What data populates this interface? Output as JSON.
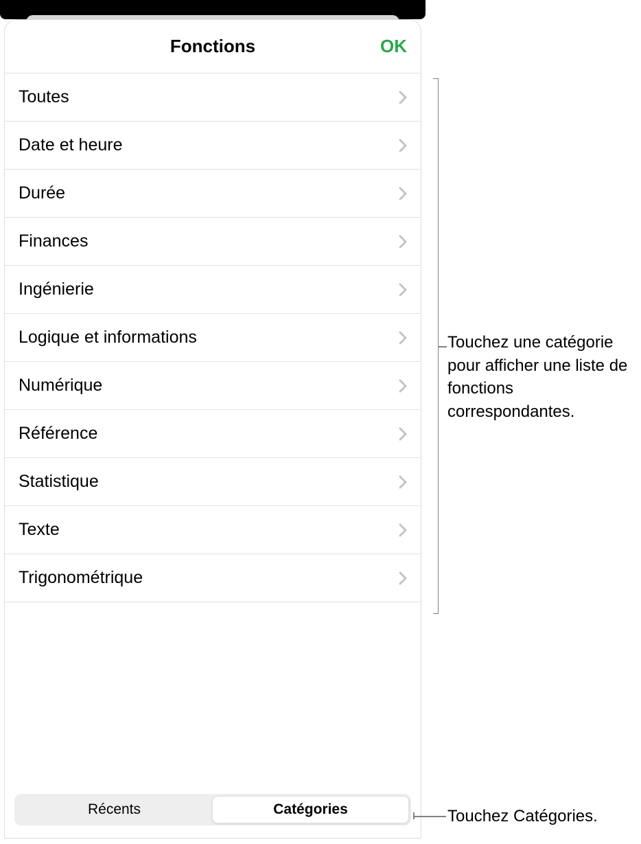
{
  "panel": {
    "title": "Fonctions",
    "ok_label": "OK"
  },
  "categories": [
    {
      "label": "Toutes",
      "id": "all"
    },
    {
      "label": "Date et heure",
      "id": "date-time"
    },
    {
      "label": "Durée",
      "id": "duration"
    },
    {
      "label": "Finances",
      "id": "finance"
    },
    {
      "label": "Ingénierie",
      "id": "engineering"
    },
    {
      "label": "Logique et informations",
      "id": "logic-info"
    },
    {
      "label": "Numérique",
      "id": "numeric"
    },
    {
      "label": "Référence",
      "id": "reference"
    },
    {
      "label": "Statistique",
      "id": "statistical"
    },
    {
      "label": "Texte",
      "id": "text"
    },
    {
      "label": "Trigonométrique",
      "id": "trigonometric"
    }
  ],
  "segments": {
    "recent": "Récents",
    "categories": "Catégories",
    "active": "categories"
  },
  "callouts": {
    "list": "Touchez une catégorie pour afficher une liste de fonctions correspondantes.",
    "tab": "Touchez Catégories."
  }
}
